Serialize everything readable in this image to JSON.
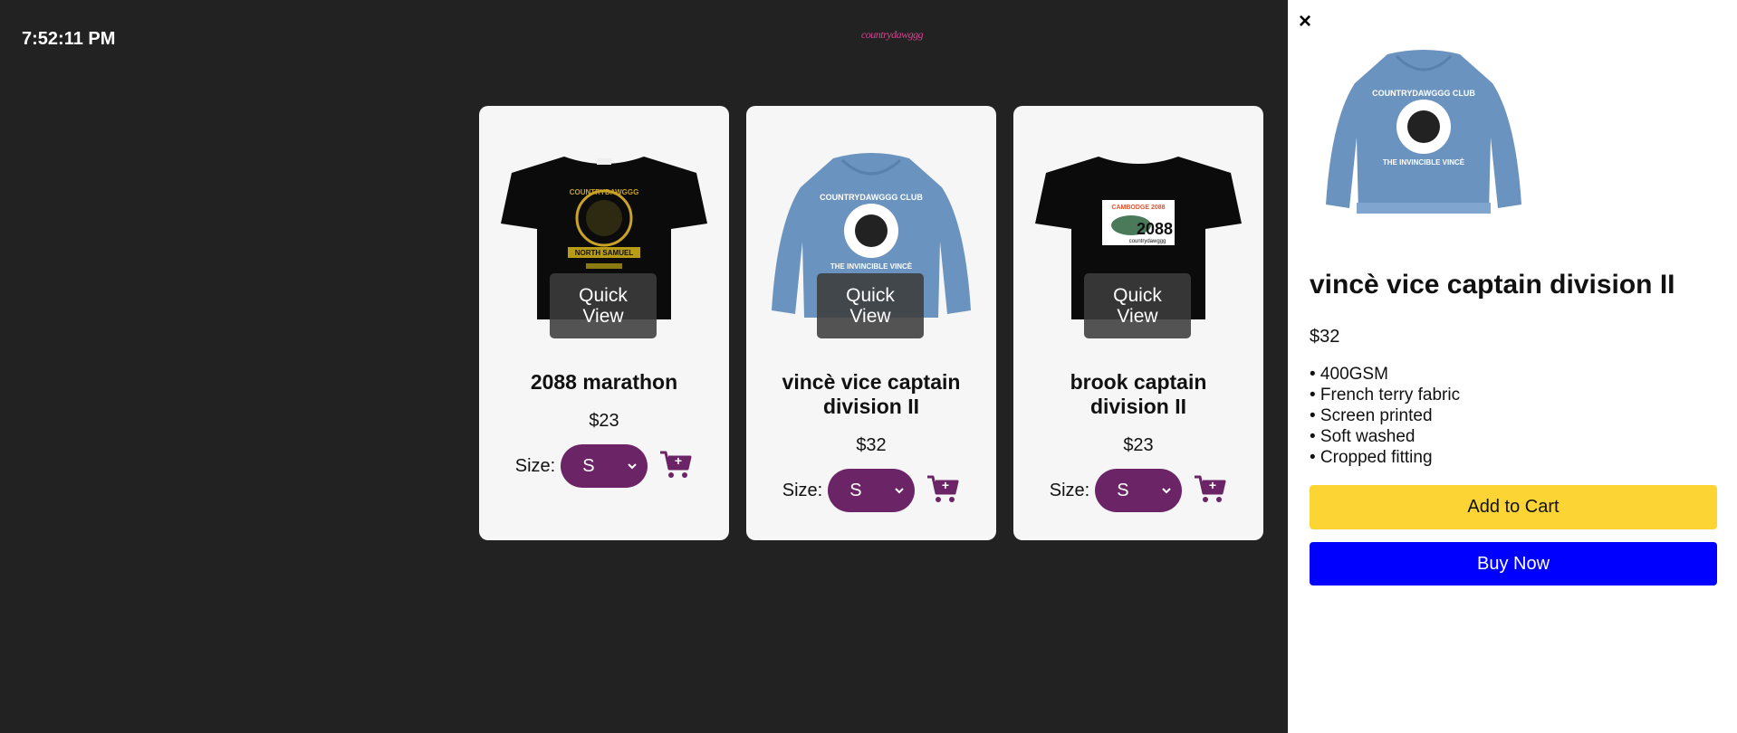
{
  "header": {
    "clock": "7:52:11 PM",
    "brand_logo": "countrydawggg",
    "brand_color": "#d4458f"
  },
  "products": [
    {
      "name": "2088 marathon",
      "price": "$23",
      "size_label": "Size:",
      "size_value": "S",
      "quick_view_label": "Quick View",
      "image": "black-tshirt-yellow-graphic",
      "cart_icon": "add-to-cart-icon"
    },
    {
      "name": "vincè vice captain division II",
      "price": "$32",
      "size_label": "Size:",
      "size_value": "S",
      "quick_view_label": "Quick View",
      "image": "blue-hoodie-countrydawggg-club",
      "cart_icon": "add-to-cart-icon"
    },
    {
      "name": "brook captain division II",
      "price": "$23",
      "size_label": "Size:",
      "size_value": "S",
      "quick_view_label": "Quick View",
      "image": "black-tshirt-cambodge-2088-bib",
      "cart_icon": "add-to-cart-icon"
    }
  ],
  "panel": {
    "close_label": "×",
    "title": "vincè vice captain division II",
    "price": "$32",
    "features": [
      "• 400GSM",
      "• French terry fabric",
      "• Screen printed",
      "• Soft washed",
      "• Cropped fitting"
    ],
    "add_to_cart_label": "Add to Cart",
    "buy_now_label": "Buy Now",
    "image": "blue-hoodie-countrydawggg-club"
  },
  "colors": {
    "page_bg": "#222222",
    "card_bg": "#f6f6f6",
    "size_select_bg": "#6b2566",
    "cart_icon": "#6b2566",
    "add_to_cart_bg": "#fcd535",
    "buy_now_bg": "#0000ff"
  },
  "hoodie_print": {
    "top_text": "COUNTRYDAWGGG CLUB",
    "bottom_text": "THE INVINCIBLE VINCÈ"
  },
  "tshirt_bib": {
    "top_text": "CAMBODGE 2088",
    "number": "2088",
    "bottom_text": "countrydawggg"
  },
  "tshirt_graphic": {
    "top_text": "COUNTRYDAWGGG",
    "middle_text": "NORTH SAMUEL"
  }
}
